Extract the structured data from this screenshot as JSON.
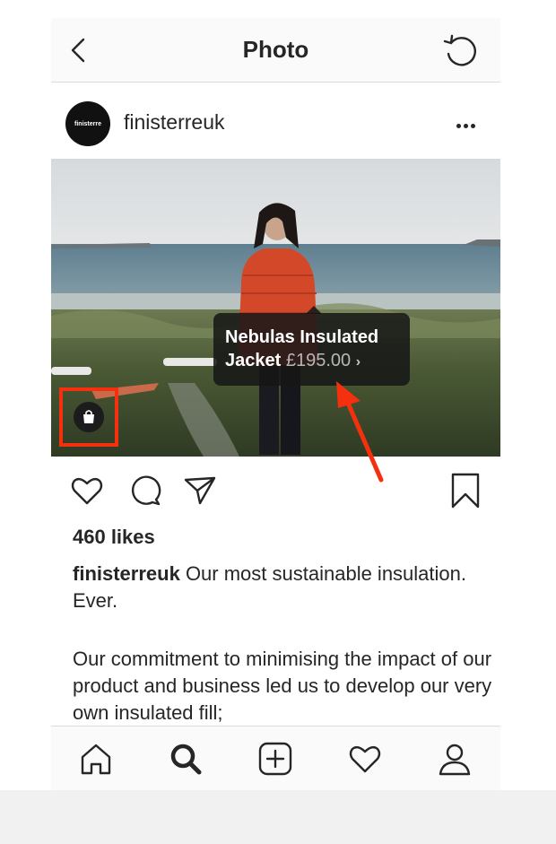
{
  "header": {
    "title": "Photo",
    "back_icon": "chevron-left-icon",
    "refresh_icon": "refresh-icon"
  },
  "post": {
    "avatar_text": "finisterre",
    "username": "finisterreuk",
    "more_icon": "more-dots-icon"
  },
  "product_tag": {
    "name_line1": "Nebulas Insulated",
    "name_line2": "Jacket",
    "price": "£195.00",
    "chevron": "›"
  },
  "shopping_icon": "shopping-bag-icon",
  "annotation": {
    "highlight_color": "#f4300f"
  },
  "actions": {
    "like_icon": "heart-icon",
    "comment_icon": "comment-icon",
    "share_icon": "send-icon",
    "save_icon": "bookmark-icon"
  },
  "likes": "460 likes",
  "caption": {
    "username": "finisterreuk",
    "text": " Our most sustainable insulation. Ever.",
    "paragraph2": "Our commitment to minimising the impact of our product and business led us to develop our very own insulated fill;"
  },
  "tabbar": {
    "home_icon": "home-icon",
    "search_icon": "search-icon",
    "add_icon": "add-post-icon",
    "activity_icon": "heart-icon",
    "profile_icon": "profile-icon"
  }
}
